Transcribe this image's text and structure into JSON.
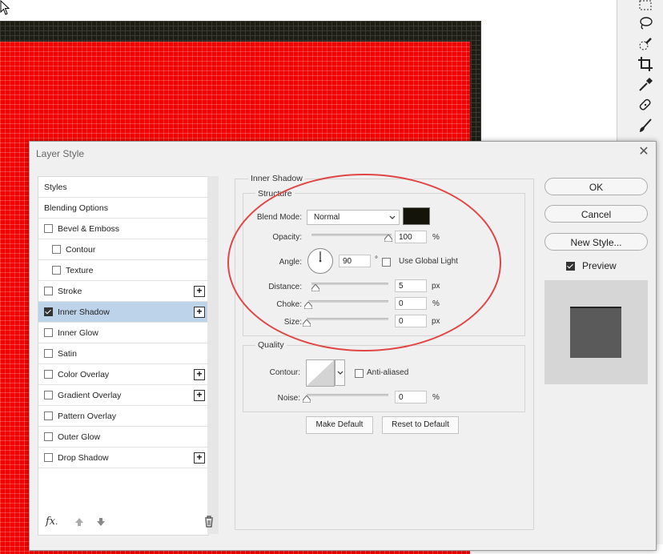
{
  "dialog": {
    "title": "Layer Style",
    "close_glyph": "✕"
  },
  "style_list": {
    "items": [
      {
        "label": "Styles",
        "checkbox": false,
        "plus": false,
        "indent": 0,
        "checked": false,
        "selected": false
      },
      {
        "label": "Blending Options",
        "checkbox": false,
        "plus": false,
        "indent": 0,
        "checked": false,
        "selected": false
      },
      {
        "label": "Bevel & Emboss",
        "checkbox": true,
        "plus": false,
        "indent": 0,
        "checked": false,
        "selected": false
      },
      {
        "label": "Contour",
        "checkbox": true,
        "plus": false,
        "indent": 1,
        "checked": false,
        "selected": false
      },
      {
        "label": "Texture",
        "checkbox": true,
        "plus": false,
        "indent": 1,
        "checked": false,
        "selected": false
      },
      {
        "label": "Stroke",
        "checkbox": true,
        "plus": true,
        "indent": 0,
        "checked": false,
        "selected": false
      },
      {
        "label": "Inner Shadow",
        "checkbox": true,
        "plus": true,
        "indent": 0,
        "checked": true,
        "selected": true
      },
      {
        "label": "Inner Glow",
        "checkbox": true,
        "plus": false,
        "indent": 0,
        "checked": false,
        "selected": false
      },
      {
        "label": "Satin",
        "checkbox": true,
        "plus": false,
        "indent": 0,
        "checked": false,
        "selected": false
      },
      {
        "label": "Color Overlay",
        "checkbox": true,
        "plus": true,
        "indent": 0,
        "checked": false,
        "selected": false
      },
      {
        "label": "Gradient Overlay",
        "checkbox": true,
        "plus": true,
        "indent": 0,
        "checked": false,
        "selected": false
      },
      {
        "label": "Pattern Overlay",
        "checkbox": true,
        "plus": false,
        "indent": 0,
        "checked": false,
        "selected": false
      },
      {
        "label": "Outer Glow",
        "checkbox": true,
        "plus": false,
        "indent": 0,
        "checked": false,
        "selected": false
      },
      {
        "label": "Drop Shadow",
        "checkbox": true,
        "plus": true,
        "indent": 0,
        "checked": false,
        "selected": false
      }
    ],
    "footer": {
      "fx_label": "fx",
      "fx_suffix": "."
    }
  },
  "inner_shadow": {
    "title": "Inner Shadow",
    "structure": {
      "legend": "Structure",
      "blend_mode_label": "Blend Mode:",
      "blend_mode_value": "Normal",
      "shadow_color": "#14140a",
      "opacity_label": "Opacity:",
      "opacity_value": "100",
      "opacity_unit": "%",
      "opacity_fraction": 1.0,
      "angle_label": "Angle:",
      "angle_value": "90",
      "angle_unit": "°",
      "use_global_light_label": "Use Global Light",
      "use_global_light_checked": false,
      "distance_label": "Distance:",
      "distance_value": "5",
      "distance_unit": "px",
      "distance_fraction": 0.05,
      "choke_label": "Choke:",
      "choke_value": "0",
      "choke_unit": "%",
      "choke_fraction": 0.0,
      "size_label": "Size:",
      "size_value": "0",
      "size_unit": "px",
      "size_fraction": 0.0
    },
    "quality": {
      "legend": "Quality",
      "contour_label": "Contour:",
      "anti_aliased_label": "Anti-aliased",
      "anti_aliased_checked": false,
      "noise_label": "Noise:",
      "noise_value": "0",
      "noise_unit": "%",
      "noise_fraction": 0.0
    },
    "make_default_label": "Make Default",
    "reset_default_label": "Reset to Default"
  },
  "actions": {
    "ok_label": "OK",
    "cancel_label": "Cancel",
    "new_style_label": "New Style...",
    "preview_label": "Preview",
    "preview_checked": true,
    "preview_swatch_color": "#5a5a5a"
  },
  "colors": {
    "canvas_red": "#f50000",
    "canvas_dark": "#1d1d16",
    "selection_highlight": "#bcd3ea",
    "annotation_ellipse": "#e04646"
  },
  "toolbar": {
    "icons": [
      "marquee-icon",
      "lasso-icon",
      "quick-selection-icon",
      "crop-icon",
      "eyedropper-icon",
      "healing-brush-icon",
      "brush-icon"
    ]
  }
}
